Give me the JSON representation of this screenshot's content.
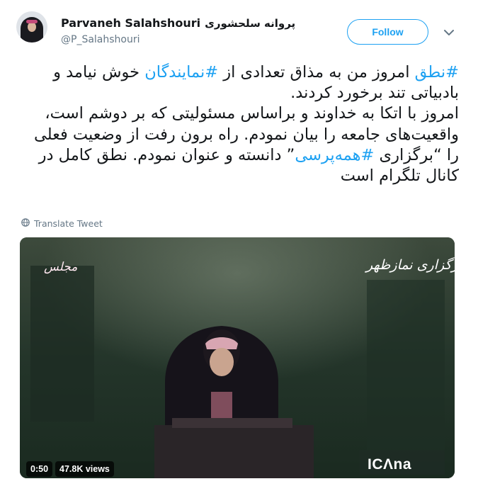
{
  "author": {
    "name": "Parvaneh Salahshouri",
    "name_fa": "پروانه سلحشوری",
    "handle": "@P_Salahshouri"
  },
  "actions": {
    "follow_label": "Follow",
    "menu_icon": "chevron-down-icon"
  },
  "tweet": {
    "p1_hashtag1": "#نطق",
    "p1_text1": " امروز من به مذاق تعدادی از ",
    "p1_hashtag2": "#نمایندگان",
    "p1_text2": " خوش نیامد و بادبیاتی تند برخورد کردند.",
    "p2_text1": "امروز با اتکا به خداوند و براساس مسئولیتی که بر دوشم است، واقعیت‌های جامعه را بیان نمودم. راه برون رفت از وضعیت فعلی را “برگزاری ",
    "p2_hashtag": "#همه‌پرسی",
    "p2_text2": "” دانسته و عنوان نمودم. نطق کامل در کانال تلگرام است"
  },
  "translate_label": "Translate Tweet",
  "video": {
    "overlay_caption": "برگزاری نمازظهر",
    "overlay_left": "مجلس",
    "logo_text": "ICΛna",
    "duration": "0:50",
    "views": "47.8K views"
  },
  "colors": {
    "link": "#1da1f2",
    "secondary_text": "#657786",
    "text": "#14171a"
  }
}
